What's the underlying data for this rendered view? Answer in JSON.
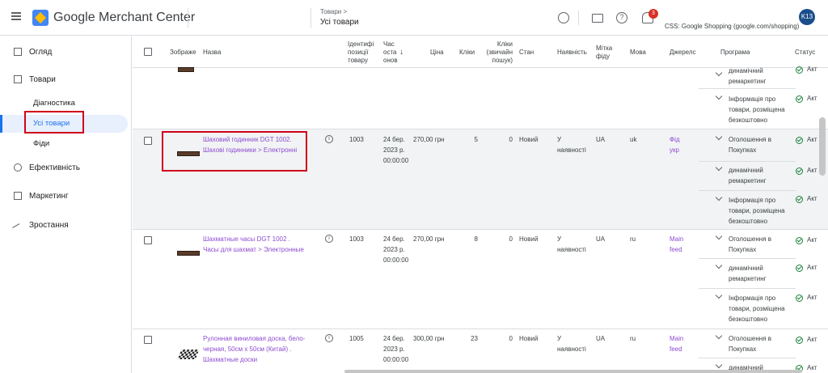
{
  "header": {
    "app_title": "Google Merchant Center",
    "breadcrumb": "Товари >",
    "page_title": "Усі товари",
    "bell_count": "3",
    "account": "CSS: Google Shopping (google.com/shopping)",
    "avatar": "K13"
  },
  "sidebar": {
    "items": [
      {
        "label": "Огляд"
      },
      {
        "label": "Товари"
      },
      {
        "label": "Діагностика"
      },
      {
        "label": "Усі товари"
      },
      {
        "label": "Фіди"
      },
      {
        "label": "Ефективність"
      },
      {
        "label": "Маркетинг"
      },
      {
        "label": "Зростання"
      }
    ]
  },
  "table": {
    "columns": {
      "image": "Зображе",
      "name": "Назва",
      "id": "Ідентифі позиції товару",
      "time": "Час оста онов",
      "sort": "↓",
      "price": "Ціна",
      "clicks": "Кліки",
      "organic": "Кліки (звичайн пошук)",
      "condition": "Стан",
      "availability": "Наявність",
      "feed_label": "Мітка фіду",
      "language": "Мова",
      "source": "Джерелс",
      "program": "Програма",
      "status": "Статус"
    },
    "top_row": {
      "programs": [
        "динамічний ремаркетинг",
        "Інформація про товари, розміщена безкоштовно"
      ],
      "status": "Акт"
    },
    "rows": [
      {
        "name": "Шаховий годинник DGT 1002. Шахові годинники > Електронні",
        "id": "1003",
        "time": "24 бер. 2023 р. 00:00:00",
        "price": "270,00 грн",
        "clicks": "5",
        "organic": "0",
        "condition": "Новий",
        "availability": "У наявності",
        "feed_label": "UA",
        "language": "uk",
        "source": "Фід укр",
        "programs": [
          "Оголошення в Покупках",
          "динамічний ремаркетинг",
          "Інформація про товари, розміщена безкоштовно"
        ],
        "status": "Акт"
      },
      {
        "name": "Шахматные часы DGT 1002 . Часы для шахмат > Электронные",
        "id": "1003",
        "time": "24 бер. 2023 р. 00:00:00",
        "price": "270,00 грн",
        "clicks": "8",
        "organic": "0",
        "condition": "Новий",
        "availability": "У наявності",
        "feed_label": "UA",
        "language": "ru",
        "source": "Main feed",
        "programs": [
          "Оголошення в Покупках",
          "динамічний ремаркетинг",
          "Інформація про товари, розміщена безкоштовно"
        ],
        "status": "Акт"
      },
      {
        "name": "Рулонная виниловая доска, бело-черная, 50см х 50см (Китай) . Шахматные доски",
        "id": "1005",
        "time": "24 бер. 2023 р. 00:00:00",
        "price": "300,00 грн",
        "clicks": "23",
        "organic": "0",
        "condition": "Новий",
        "availability": "У наявності",
        "feed_label": "UA",
        "language": "ru",
        "source": "Main feed",
        "programs": [
          "Оголошення в Покупках",
          "динамічний"
        ],
        "status": "Акт"
      }
    ]
  }
}
